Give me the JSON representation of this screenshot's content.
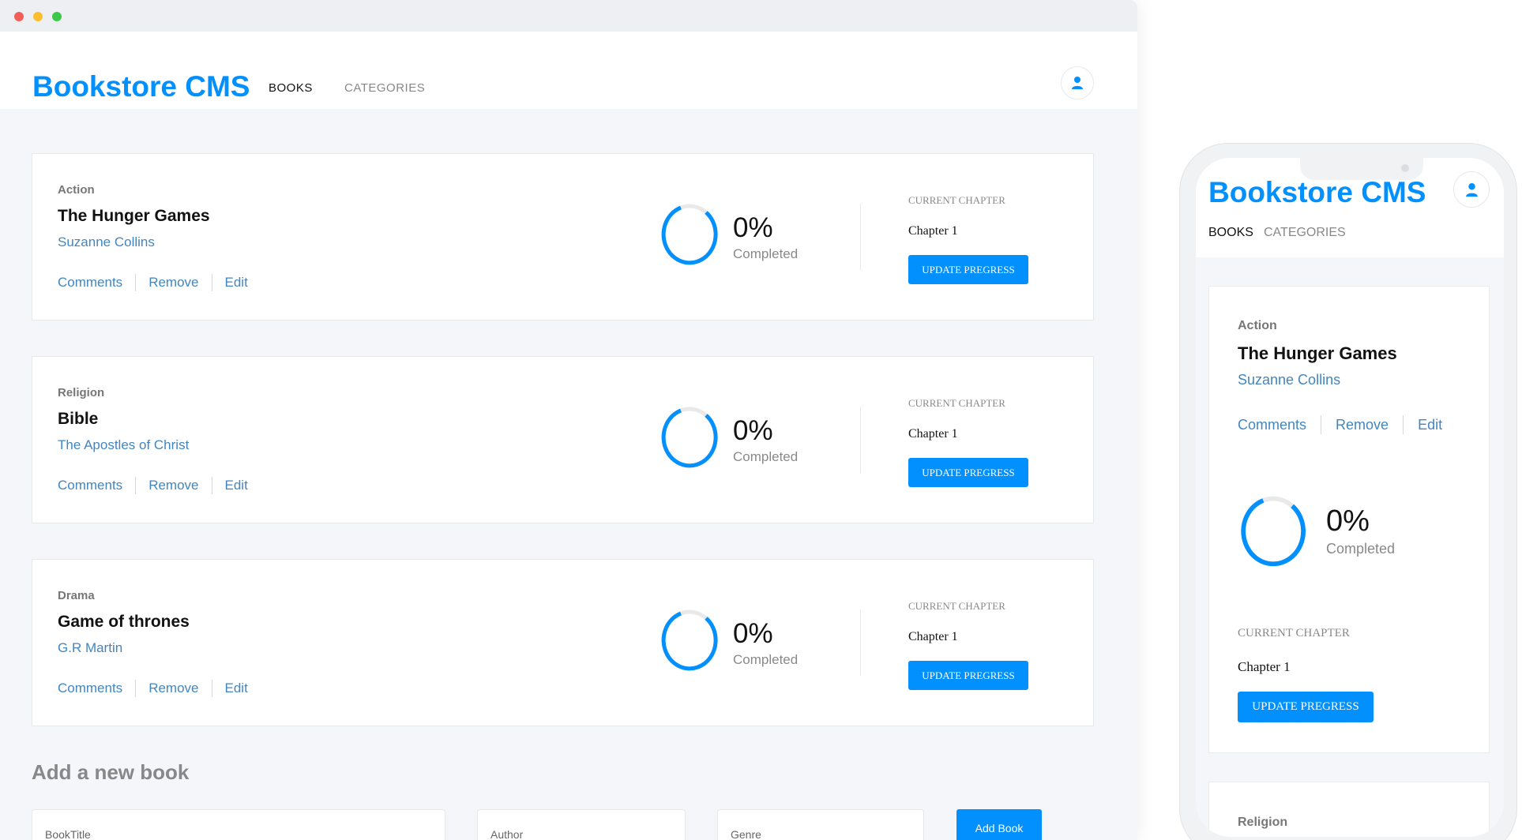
{
  "desktop": {
    "logo": "Bookstore CMS",
    "nav": {
      "books": "BOOKS",
      "categories": "CATEGORIES"
    },
    "books": [
      {
        "genre": "Action",
        "title": "The Hunger Games",
        "author": "Suzanne Collins",
        "progress_text": "0%",
        "progress": 0,
        "completed_label": "Completed",
        "current_chapter_label": "CURRENT CHAPTER",
        "chapter": "Chapter 1",
        "update_label": "UPDATE PREGRESS"
      },
      {
        "genre": "Religion",
        "title": "Bible",
        "author": "The Apostles of Christ",
        "progress_text": "0%",
        "progress": 0,
        "completed_label": "Completed",
        "current_chapter_label": "CURRENT CHAPTER",
        "chapter": "Chapter 1",
        "update_label": "UPDATE PREGRESS"
      },
      {
        "genre": "Drama",
        "title": "Game of thrones",
        "author": "G.R Martin",
        "progress_text": "0%",
        "progress": 0,
        "completed_label": "Completed",
        "current_chapter_label": "CURRENT CHAPTER",
        "chapter": "Chapter 1",
        "update_label": "UPDATE PREGRESS"
      }
    ],
    "actions": {
      "comments": "Comments",
      "remove": "Remove",
      "edit": "Edit"
    },
    "add_form": {
      "heading": "Add a new book",
      "title_placeholder": "BookTitle",
      "author_placeholder": "Author",
      "genre_placeholder": "Genre",
      "button": "Add Book"
    }
  },
  "mobile": {
    "logo": "Bookstore CMS",
    "nav": {
      "books": "BOOKS",
      "categories": "CATEGORIES"
    },
    "book": {
      "genre": "Action",
      "title": "The Hunger Games",
      "author": "Suzanne Collins",
      "progress_text": "0%",
      "progress": 0,
      "completed_label": "Completed",
      "current_chapter_label": "CURRENT CHAPTER",
      "chapter": "Chapter 1",
      "update_label": "UPDATE PREGRESS"
    },
    "actions": {
      "comments": "Comments",
      "remove": "Remove",
      "edit": "Edit"
    },
    "next_genre": "Religion"
  },
  "colors": {
    "accent": "#0290ff",
    "link": "#4386bf",
    "background": "#f5f6fa"
  },
  "icons": {
    "user": "user-icon"
  }
}
